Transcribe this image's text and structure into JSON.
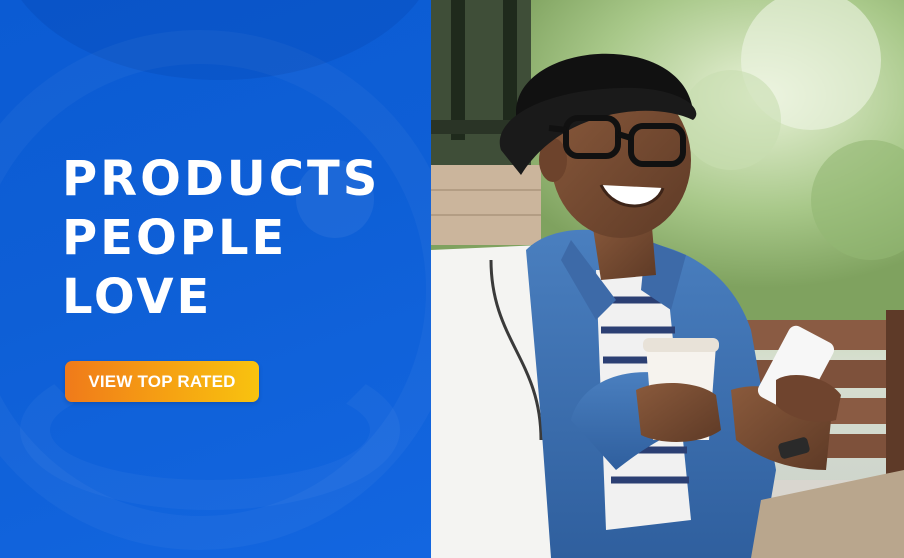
{
  "headline": {
    "line1": "PRODUCTS",
    "line2": "PEOPLE",
    "line3": "LOVE"
  },
  "cta": {
    "label": "VIEW TOP RATED"
  },
  "colors": {
    "panel_blue": "#0e5fd6",
    "cta_orange": "#f07a1a",
    "cta_yellow": "#f8c30f",
    "text": "#ffffff"
  },
  "photo": {
    "subject": "smiling-man-with-coffee-and-phone"
  }
}
